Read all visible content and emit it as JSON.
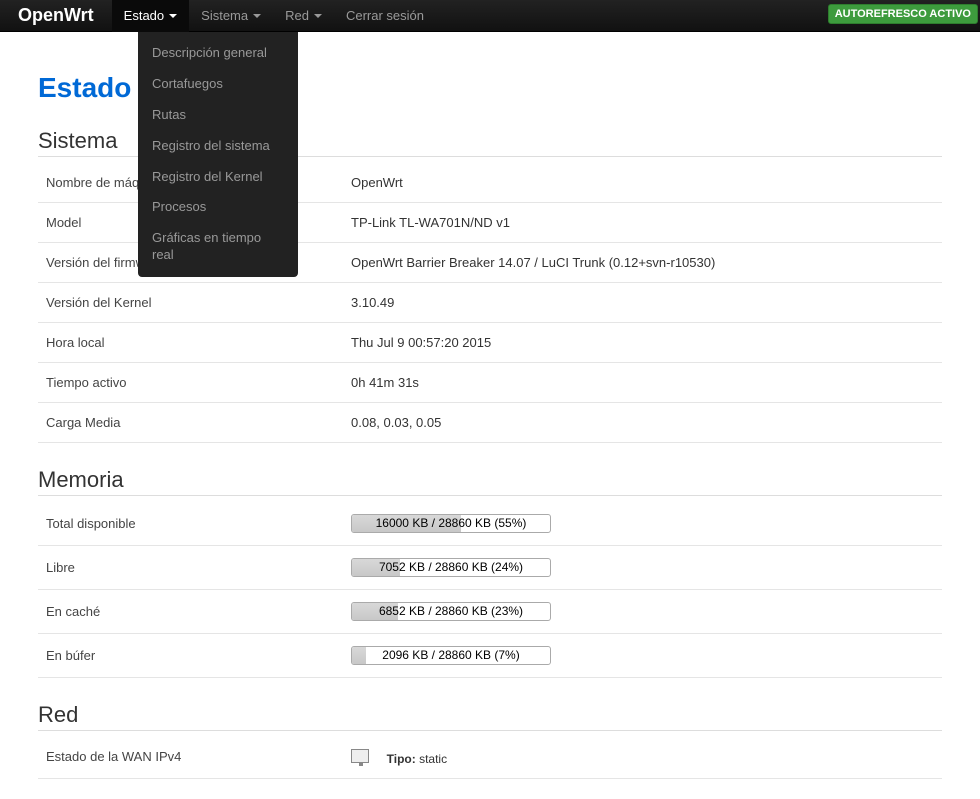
{
  "navbar": {
    "brand": "OpenWrt",
    "items": [
      {
        "label": "Estado",
        "hasDropdown": true,
        "active": true
      },
      {
        "label": "Sistema",
        "hasDropdown": true
      },
      {
        "label": "Red",
        "hasDropdown": true
      },
      {
        "label": "Cerrar sesión",
        "hasDropdown": false
      }
    ],
    "autorefresh": "AUTOREFRESCO ACTIVO"
  },
  "dropdown": {
    "items": [
      "Descripción general",
      "Cortafuegos",
      "Rutas",
      "Registro del sistema",
      "Registro del Kernel",
      "Procesos",
      "Gráficas en tiempo real"
    ]
  },
  "page": {
    "title": "Estado"
  },
  "system": {
    "heading": "Sistema",
    "rows": [
      {
        "label": "Nombre de máquina",
        "value": "OpenWrt"
      },
      {
        "label": "Model",
        "value": "TP-Link TL-WA701N/ND v1"
      },
      {
        "label": "Versión del firmware",
        "value": "OpenWrt Barrier Breaker 14.07 / LuCI Trunk (0.12+svn-r10530)"
      },
      {
        "label": "Versión del Kernel",
        "value": "3.10.49"
      },
      {
        "label": "Hora local",
        "value": "Thu Jul 9 00:57:20 2015"
      },
      {
        "label": "Tiempo activo",
        "value": "0h 41m 31s"
      },
      {
        "label": "Carga Media",
        "value": "0.08, 0.03, 0.05"
      }
    ]
  },
  "memory": {
    "heading": "Memoria",
    "rows": [
      {
        "label": "Total disponible",
        "text": "16000 KB / 28860 KB (55%)",
        "pct": 55
      },
      {
        "label": "Libre",
        "text": "7052 KB / 28860 KB (24%)",
        "pct": 24
      },
      {
        "label": "En caché",
        "text": "6852 KB / 28860 KB (23%)",
        "pct": 23
      },
      {
        "label": "En búfer",
        "text": "2096 KB / 28860 KB (7%)",
        "pct": 7
      }
    ]
  },
  "network": {
    "heading": "Red",
    "wan": {
      "label": "Estado de la WAN IPv4",
      "type_label": "Tipo:",
      "type_value": "static"
    }
  }
}
